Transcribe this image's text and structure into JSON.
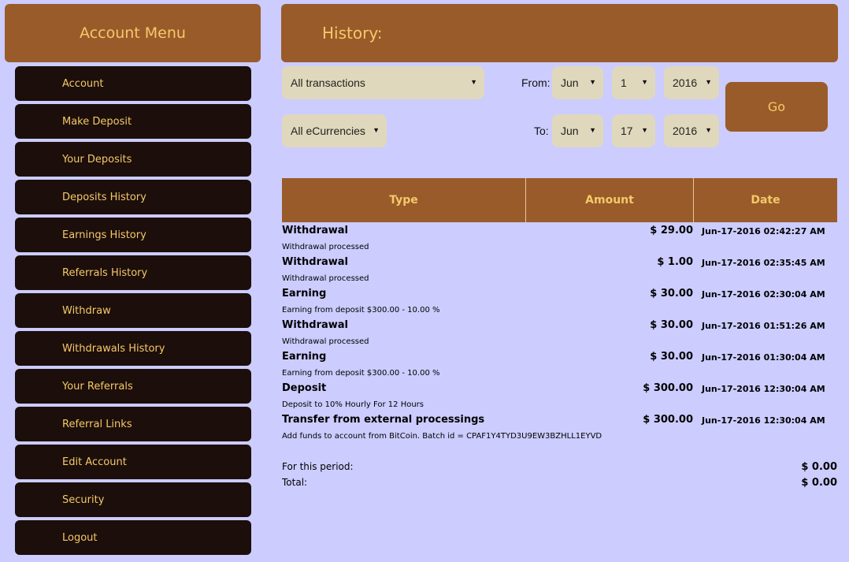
{
  "sidebar": {
    "title": "Account Menu",
    "items": [
      {
        "label": "Account"
      },
      {
        "label": "Make Deposit"
      },
      {
        "label": "Your Deposits"
      },
      {
        "label": "Deposits History"
      },
      {
        "label": "Earnings History"
      },
      {
        "label": "Referrals History"
      },
      {
        "label": "Withdraw"
      },
      {
        "label": "Withdrawals History"
      },
      {
        "label": "Your Referrals"
      },
      {
        "label": "Referral Links"
      },
      {
        "label": "Edit Account"
      },
      {
        "label": "Security"
      },
      {
        "label": "Logout"
      }
    ]
  },
  "main": {
    "title": "History:"
  },
  "filters": {
    "transaction_type": "All transactions",
    "currency": "All eCurrencies",
    "from_label": "From:",
    "to_label": "To:",
    "from": {
      "month": "Jun",
      "day": "1",
      "year": "2016"
    },
    "to": {
      "month": "Jun",
      "day": "17",
      "year": "2016"
    },
    "go_label": "Go"
  },
  "table": {
    "headers": {
      "type": "Type",
      "amount": "Amount",
      "date": "Date"
    },
    "rows": [
      {
        "type": "Withdrawal",
        "amount": "$ 29.00",
        "date": "Jun-17-2016 02:42:27 AM",
        "desc": "Withdrawal processed"
      },
      {
        "type": "Withdrawal",
        "amount": "$ 1.00",
        "date": "Jun-17-2016 02:35:45 AM",
        "desc": "Withdrawal processed"
      },
      {
        "type": "Earning",
        "amount": "$ 30.00",
        "date": "Jun-17-2016 02:30:04 AM",
        "desc": "Earning from deposit $300.00 - 10.00 %"
      },
      {
        "type": "Withdrawal",
        "amount": "$ 30.00",
        "date": "Jun-17-2016 01:51:26 AM",
        "desc": "Withdrawal processed"
      },
      {
        "type": "Earning",
        "amount": "$ 30.00",
        "date": "Jun-17-2016 01:30:04 AM",
        "desc": "Earning from deposit $300.00 - 10.00 %"
      },
      {
        "type": "Deposit",
        "amount": "$ 300.00",
        "date": "Jun-17-2016 12:30:04 AM",
        "desc": "Deposit to 10% Hourly For 12 Hours"
      },
      {
        "type": "Transfer from external processings",
        "amount": "$ 300.00",
        "date": "Jun-17-2016 12:30:04 AM",
        "desc": "Add funds to account from BitCoin. Batch id = CPAF1Y4TYD3U9EW3BZHLL1EYVD"
      }
    ]
  },
  "totals": {
    "period_label": "For this period:",
    "period_value": "$ 0.00",
    "total_label": "Total:",
    "total_value": "$ 0.00"
  },
  "colors": {
    "background": "#ccccff",
    "brown": "#9a5b2a",
    "menu_dark": "#1c0e0a",
    "gold_text": "#f4c96a",
    "select_bg": "#e0d8bc"
  }
}
